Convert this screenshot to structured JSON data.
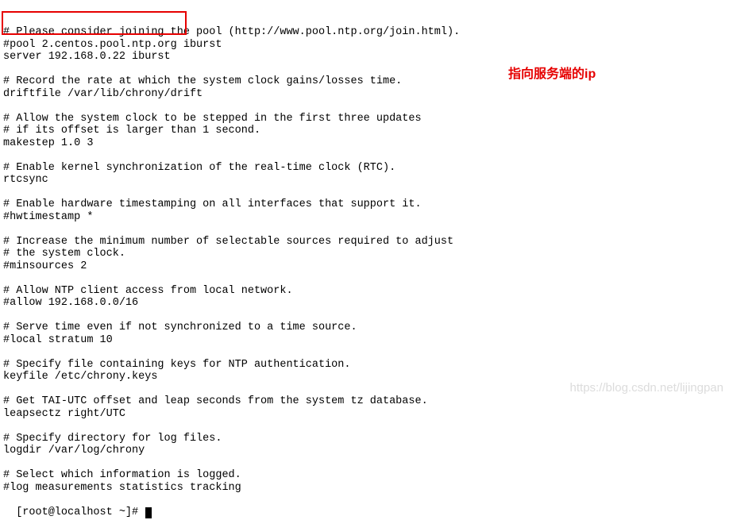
{
  "terminal": {
    "lines": [
      "# Please consider joining the pool (http://www.pool.ntp.org/join.html).",
      "#pool 2.centos.pool.ntp.org iburst",
      "server 192.168.0.22 iburst",
      "",
      "# Record the rate at which the system clock gains/losses time.",
      "driftfile /var/lib/chrony/drift",
      "",
      "# Allow the system clock to be stepped in the first three updates",
      "# if its offset is larger than 1 second.",
      "makestep 1.0 3",
      "",
      "# Enable kernel synchronization of the real-time clock (RTC).",
      "rtcsync",
      "",
      "# Enable hardware timestamping on all interfaces that support it.",
      "#hwtimestamp *",
      "",
      "# Increase the minimum number of selectable sources required to adjust",
      "# the system clock.",
      "#minsources 2",
      "",
      "# Allow NTP client access from local network.",
      "#allow 192.168.0.0/16",
      "",
      "# Serve time even if not synchronized to a time source.",
      "#local stratum 10",
      "",
      "# Specify file containing keys for NTP authentication.",
      "keyfile /etc/chrony.keys",
      "",
      "# Get TAI-UTC offset and leap seconds from the system tz database.",
      "leapsectz right/UTC",
      "",
      "# Specify directory for log files.",
      "logdir /var/log/chrony",
      "",
      "# Select which information is logged.",
      "#log measurements statistics tracking"
    ],
    "prompt": "[root@localhost ~]# "
  },
  "annotation_text": "指向服务端的ip",
  "watermark_text": "https://blog.csdn.net/lijingpan"
}
